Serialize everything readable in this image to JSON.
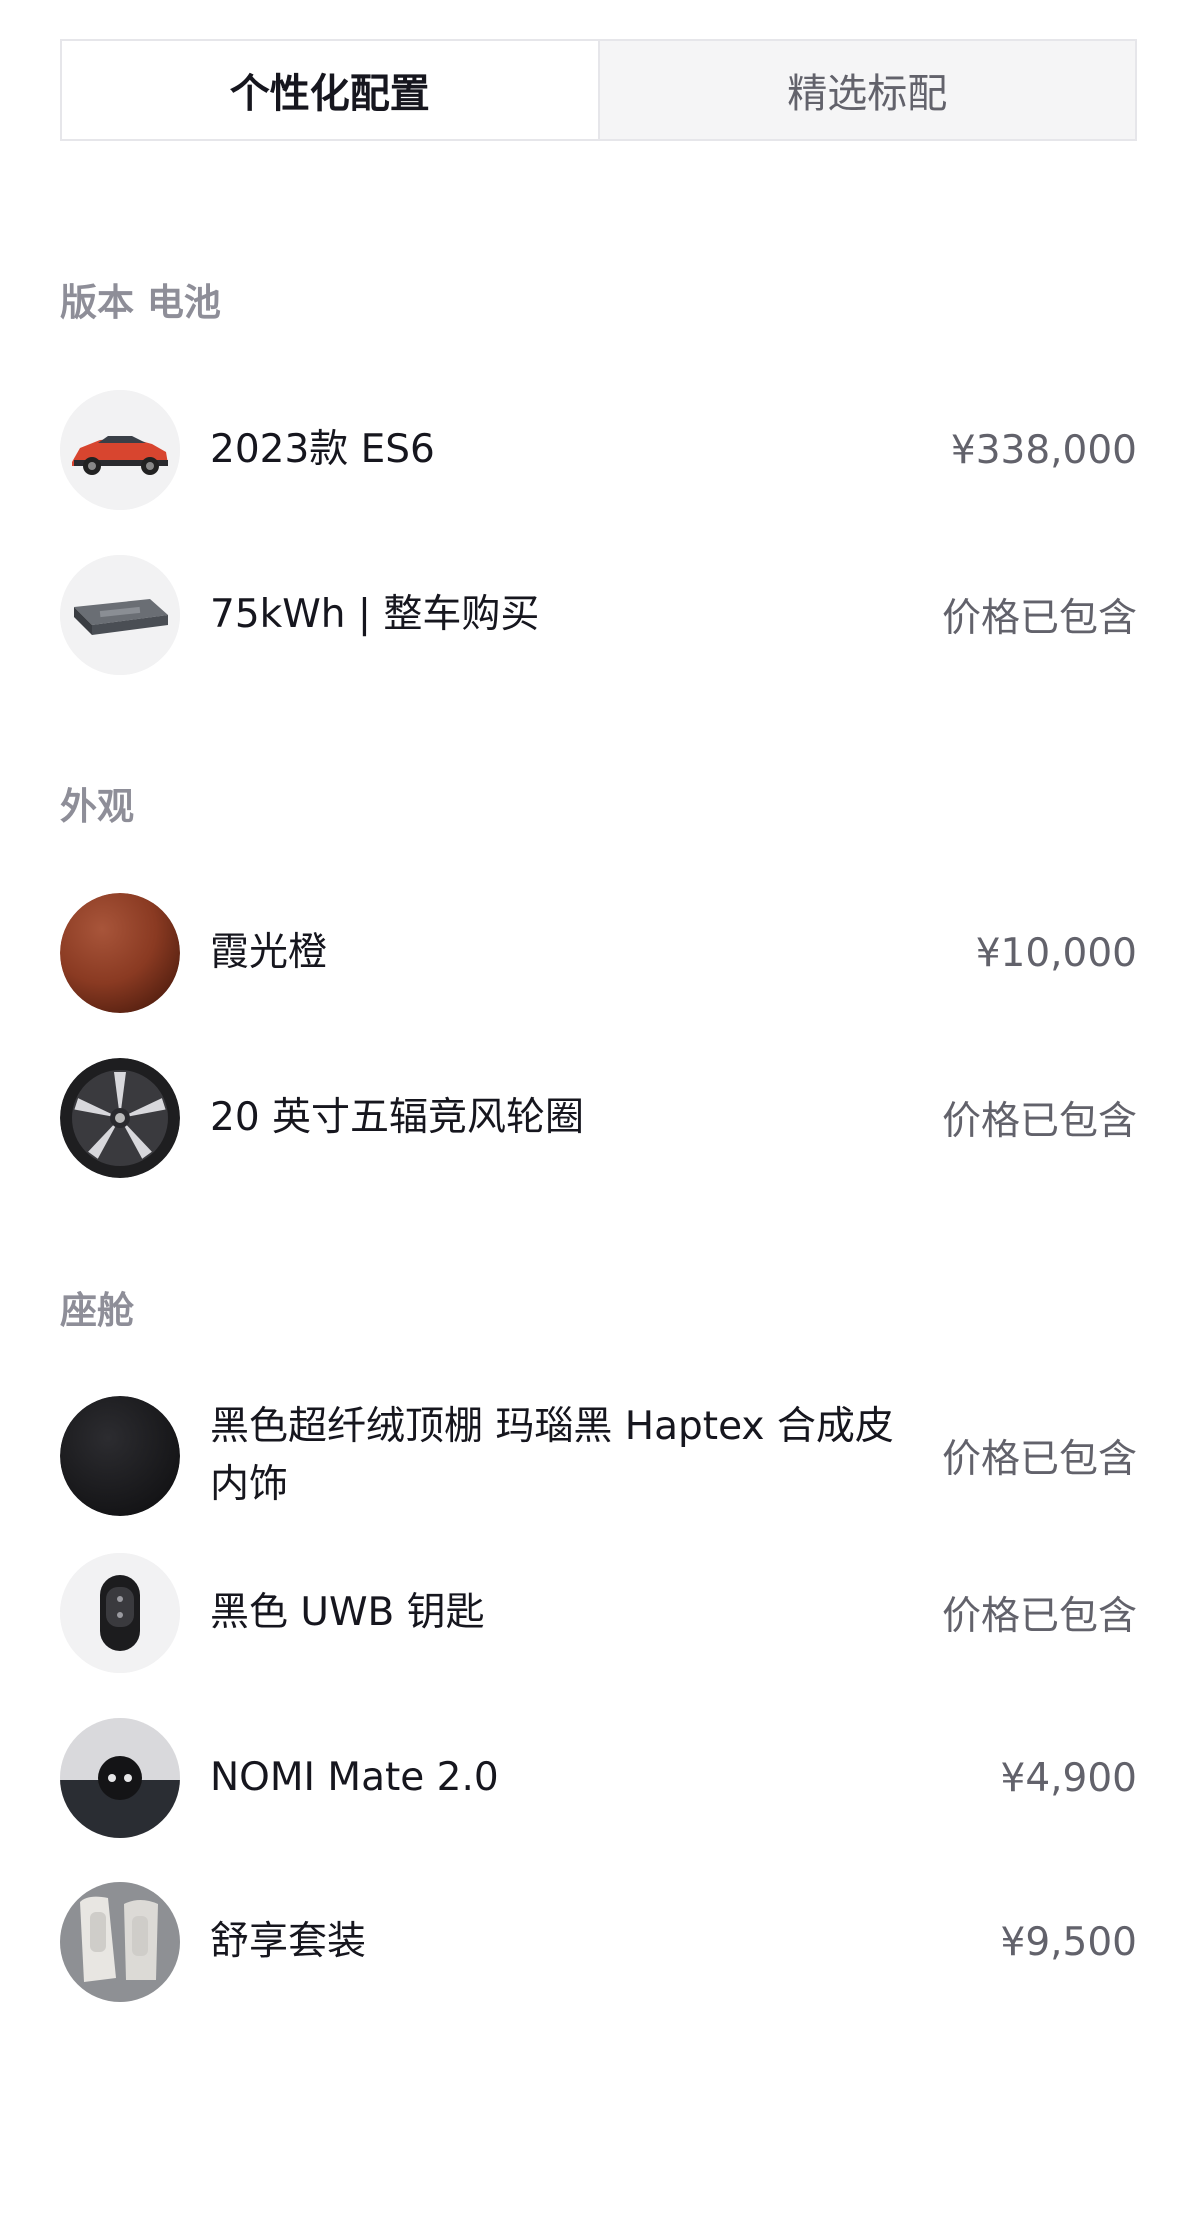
{
  "tabs": [
    {
      "label": "个性化配置",
      "active": true
    },
    {
      "label": "精选标配",
      "active": false
    }
  ],
  "sections": [
    {
      "title": "版本 电池",
      "items": [
        {
          "label": "2023款 ES6",
          "price": "¥338,000",
          "icon": "car-icon"
        },
        {
          "label": "75kWh | 整车购买",
          "price": "价格已包含",
          "icon": "battery-pack-icon"
        }
      ]
    },
    {
      "title": "外观",
      "items": [
        {
          "label": "霞光橙",
          "price": "¥10,000",
          "icon": "paint-swatch-icon"
        },
        {
          "label": "20 英寸五辐竞风轮圈",
          "price": "价格已包含",
          "icon": "wheel-icon"
        }
      ]
    },
    {
      "title": "座舱",
      "items": [
        {
          "label": "黑色超纤绒顶棚 玛瑙黑 Haptex 合成皮内饰",
          "price": "价格已包含",
          "icon": "interior-swatch-icon"
        },
        {
          "label": "黑色 UWB 钥匙",
          "price": "价格已包含",
          "icon": "key-fob-icon"
        },
        {
          "label": "NOMI Mate 2.0",
          "price": "¥4,900",
          "icon": "nomi-icon"
        },
        {
          "label": "舒享套装",
          "price": "¥9,500",
          "icon": "seat-icon"
        }
      ]
    }
  ],
  "colors": {
    "paint": "#8a3a22",
    "interior": "#1c1c1e"
  }
}
